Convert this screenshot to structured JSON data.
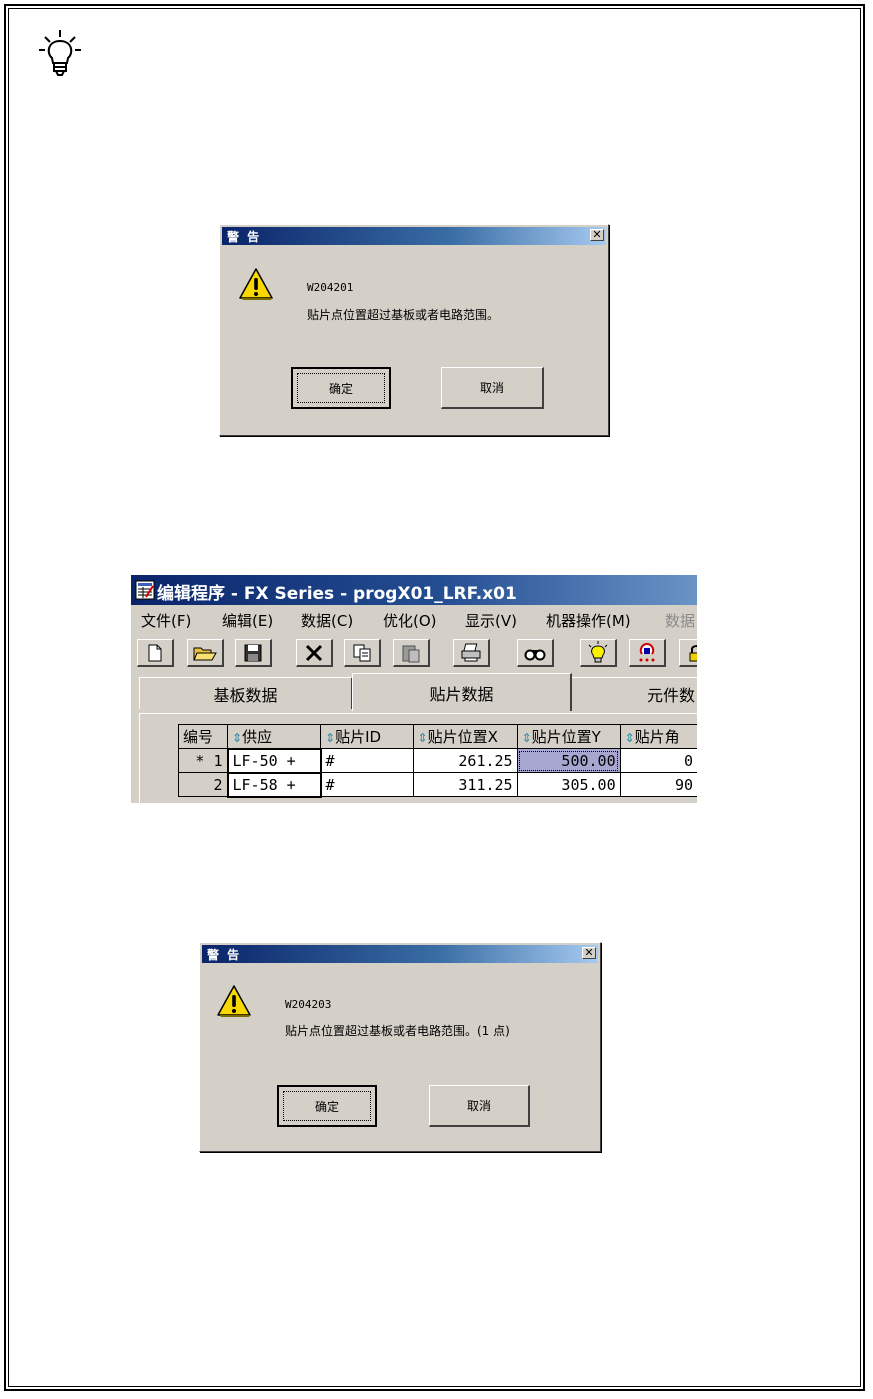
{
  "dialog1": {
    "title": "警 告",
    "close_glyph": "✕",
    "code": "W204201",
    "message": "贴片点位置超过基板或者电路范围。",
    "ok_label": "确定",
    "cancel_label": "取消"
  },
  "editor": {
    "title": "编辑程序 - FX Series - progX01_LRF.x01",
    "menu": [
      "文件(F)",
      "编辑(E)",
      "数据(C)",
      "优化(O)",
      "显示(V)",
      "机器操作(M)",
      "数据"
    ],
    "toolbar": [
      "new-file-icon",
      "open-folder-icon",
      "save-icon",
      "delete-icon",
      "copy-icon",
      "paste-icon",
      "print-icon",
      "find-icon",
      "lightbulb-icon",
      "nozzle-icon",
      "lock-icon"
    ],
    "tabs": [
      "基板数据",
      "贴片数据",
      "元件数"
    ],
    "columns": [
      "编号",
      "供应",
      "贴片ID",
      "贴片位置X",
      "贴片位置Y",
      "贴片角"
    ],
    "sort_glyph": "⇕",
    "rows": [
      {
        "no": "* 1",
        "feeder": "LF-50 +",
        "id": "#",
        "x": "261.25",
        "y": "500.00",
        "angle": "0"
      },
      {
        "no": "2",
        "feeder": "LF-58 +",
        "id": "#",
        "x": "311.25",
        "y": "305.00",
        "angle": "90"
      }
    ]
  },
  "dialog2": {
    "title": "警 告",
    "close_glyph": "✕",
    "code": "W204203",
    "message": "贴片点位置超过基板或者电路范围。(1 点)",
    "ok_label": "确定",
    "cancel_label": "取消"
  },
  "colors": {
    "titlebar": "#0a246a",
    "dialog_bg": "#d4d0c8",
    "selected_cell": "#a6a6d0",
    "warning_yellow": "#f8d800"
  }
}
